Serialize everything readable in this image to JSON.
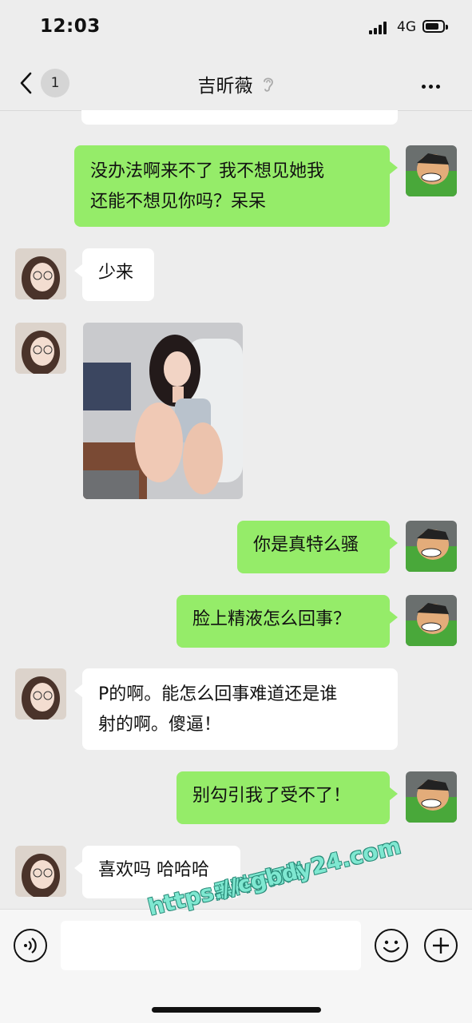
{
  "status_bar": {
    "time": "12:03",
    "network": "4G"
  },
  "nav": {
    "unread_count": "1",
    "title": "吉昕薇"
  },
  "messages": [
    {
      "side": "me",
      "lines": [
        "没办法啊来不了 我不想见她我",
        "还能不想见你吗？呆呆"
      ]
    },
    {
      "side": "them",
      "text": "少来"
    },
    {
      "side": "them",
      "type": "image",
      "icon": "photo-of-girl-in-chair"
    },
    {
      "side": "me",
      "text": "你是真特么骚"
    },
    {
      "side": "me",
      "text": "脸上精液怎么回事？"
    },
    {
      "side": "them",
      "lines": [
        "P的啊。能怎么回事难道还是谁",
        "射的啊。傻逼！"
      ]
    },
    {
      "side": "me",
      "text": "别勾引我了受不了！"
    },
    {
      "side": "them",
      "text": "喜欢吗 哈哈哈"
    }
  ],
  "watermark": {
    "line1": "黑料不打烊",
    "line2": "https://cgbdy24.com"
  },
  "input": {
    "value": ""
  },
  "colors": {
    "my_bubble": "#95ec69",
    "their_bubble": "#ffffff",
    "background": "#ededed"
  },
  "icons": {
    "voice": "voice-icon",
    "emoji": "emoji-icon",
    "plus": "plus-icon",
    "back": "back-arrow-icon",
    "more": "more-icon",
    "ear": "earpiece-icon"
  }
}
